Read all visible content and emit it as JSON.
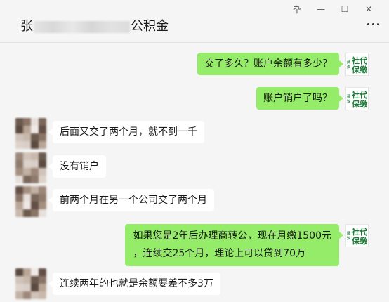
{
  "header": {
    "title_prefix": "张",
    "title_suffix": "公积金",
    "window_controls": [
      "pin-icon",
      "minimize-icon",
      "maximize-icon",
      "close-icon"
    ],
    "pin_glyph": "卆",
    "minimize_glyph": "—",
    "maximize_glyph": "☐",
    "close_glyph": "✕"
  },
  "messages": [
    {
      "side": "out",
      "text": "交了多久？账户余额有多少？"
    },
    {
      "side": "out",
      "text": "账户销户了吗？"
    },
    {
      "side": "in",
      "text": "后面又交了两个月，就不到一千"
    },
    {
      "side": "in",
      "text": "没有销户"
    },
    {
      "side": "in",
      "text": "前两个月在另一个公司交了两个月"
    },
    {
      "side": "out",
      "lines": [
        "如果您是2年后办理商转公，现在月缴1500元",
        "，连续交25个月，理论上可以贷到70万"
      ]
    },
    {
      "side": "in",
      "text": "连续两年的也就是余额要差不多3万"
    }
  ],
  "self_avatar": {
    "small_text": "武汉",
    "line1": "社代",
    "line2": "保缴",
    "color": "#1f7a3a"
  },
  "colors": {
    "outgoing_bubble": "#95ec69",
    "incoming_bubble": "#ffffff",
    "background": "#f5f5f5"
  }
}
